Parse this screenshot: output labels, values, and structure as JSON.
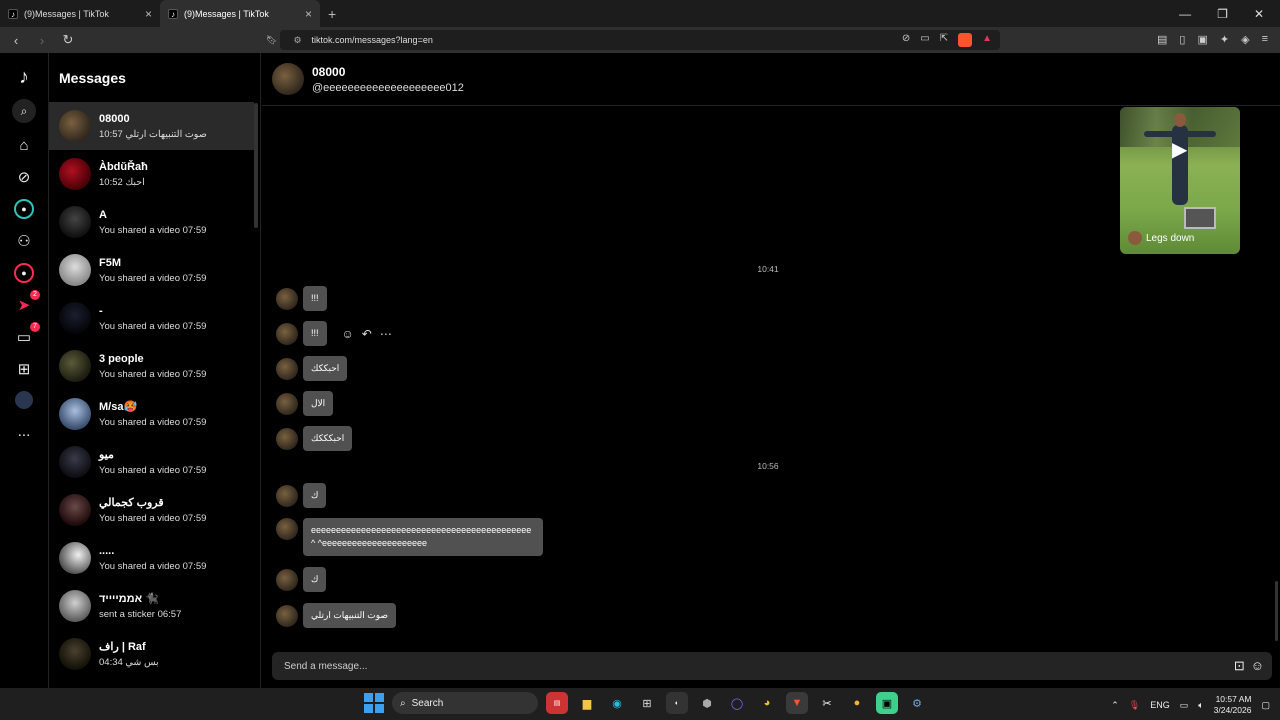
{
  "browser": {
    "tabs": [
      {
        "title": "(9)Messages | TikTok",
        "active": false
      },
      {
        "title": "(9)Messages | TikTok",
        "active": true
      }
    ],
    "url": "tiktok.com/messages?lang=en"
  },
  "sidebar_nav": {
    "badges": {
      "messages": "2",
      "inbox": "7"
    },
    "more_label": "..."
  },
  "messages_panel": {
    "title": "Messages",
    "conversations": [
      {
        "name": "08000",
        "preview": "صوت التنبيهات ارتلي 10:57"
      },
      {
        "name": "ÀbdŭŘaħ",
        "preview": "احبك 10:52"
      },
      {
        "name": "A",
        "preview": "You shared a video 07:59"
      },
      {
        "name": "F5M",
        "preview": "You shared a video 07:59"
      },
      {
        "name": "-",
        "preview": "You shared a video 07:59"
      },
      {
        "name": "3 people",
        "preview": "You shared a video 07:59"
      },
      {
        "name": "M/sa🥵",
        "preview": "You shared a video 07:59"
      },
      {
        "name": "ميو",
        "preview": "You shared a video 07:59"
      },
      {
        "name": "قروب كجمالي",
        "preview": "You shared a video 07:59"
      },
      {
        "name": ".....",
        "preview": "You shared a video 07:59"
      },
      {
        "name": "אממייייד 🐈‍⬛",
        "preview": "sent a sticker 06:57"
      },
      {
        "name": "راف | Raf",
        "preview": "بس شي 04:34"
      }
    ]
  },
  "chat": {
    "name": "08000",
    "username": "@eeeeeeeeeeeeeeeeeeee012",
    "video_caption": "Legs down",
    "timestamps": [
      "10:41",
      "10:56"
    ],
    "messages": [
      "!!!",
      "!!!",
      "احبككك",
      "الال",
      "احبكككك",
      "ك",
      "eeeeeeeeeeeeeeeeeeeeeeeeeeeeeeeeeeeeeeeeeeee^ ^eeeeeeeeeeeeeeeeeeeee",
      "ك",
      "صوت التنبيهات ارتلي"
    ],
    "composer_placeholder": "Send a message..."
  },
  "taskbar": {
    "search_label": "Search",
    "language": "ENG",
    "time": "10:57 AM",
    "date": "3/24/2026"
  }
}
